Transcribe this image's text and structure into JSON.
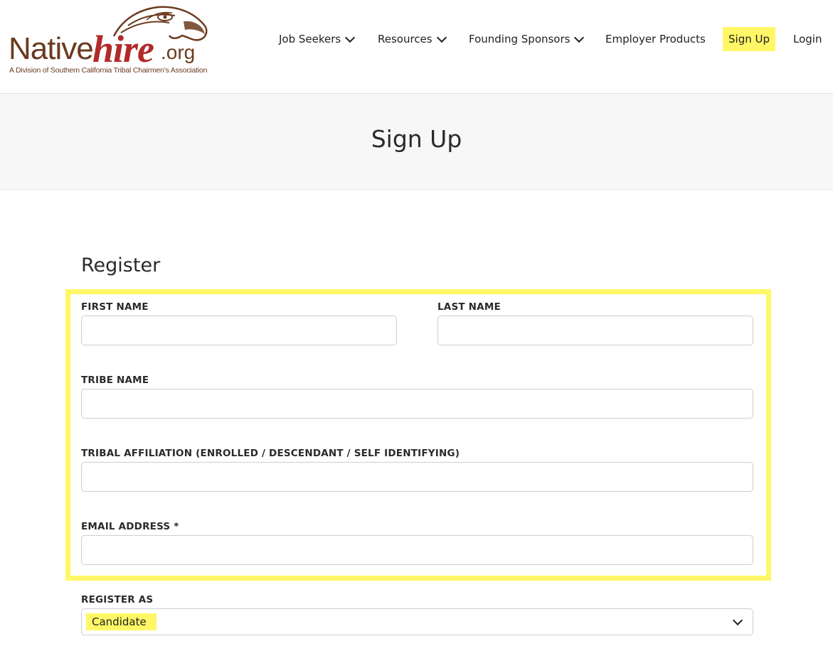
{
  "logo": {
    "native": "Native",
    "hire": "hire",
    "org": ".org",
    "tagline": "A Division of Southern California Tribal Chairmen's Association",
    "colors": {
      "brown": "#6b3a1f",
      "red": "#b22a2a"
    }
  },
  "nav": {
    "job_seekers": "Job Seekers",
    "resources": "Resources",
    "founding_sponsors": "Founding Sponsors",
    "employer_products": "Employer Products",
    "sign_up": "Sign Up",
    "login": "Login"
  },
  "page": {
    "title": "Sign Up"
  },
  "form": {
    "heading": "Register",
    "first_name": {
      "label": "FIRST NAME",
      "value": ""
    },
    "last_name": {
      "label": "LAST NAME",
      "value": ""
    },
    "tribe_name": {
      "label": "TRIBE NAME",
      "value": ""
    },
    "tribal_affiliation": {
      "label": "TRIBAL AFFILIATION (ENROLLED / DESCENDANT / SELF IDENTIFYING)",
      "value": ""
    },
    "email": {
      "label": "EMAIL ADDRESS *",
      "value": ""
    },
    "register_as": {
      "label": "REGISTER AS",
      "selected": "Candidate"
    }
  },
  "colors": {
    "highlight": "#fff766",
    "band": "#f7f7f7",
    "border": "#cfcfcf"
  }
}
